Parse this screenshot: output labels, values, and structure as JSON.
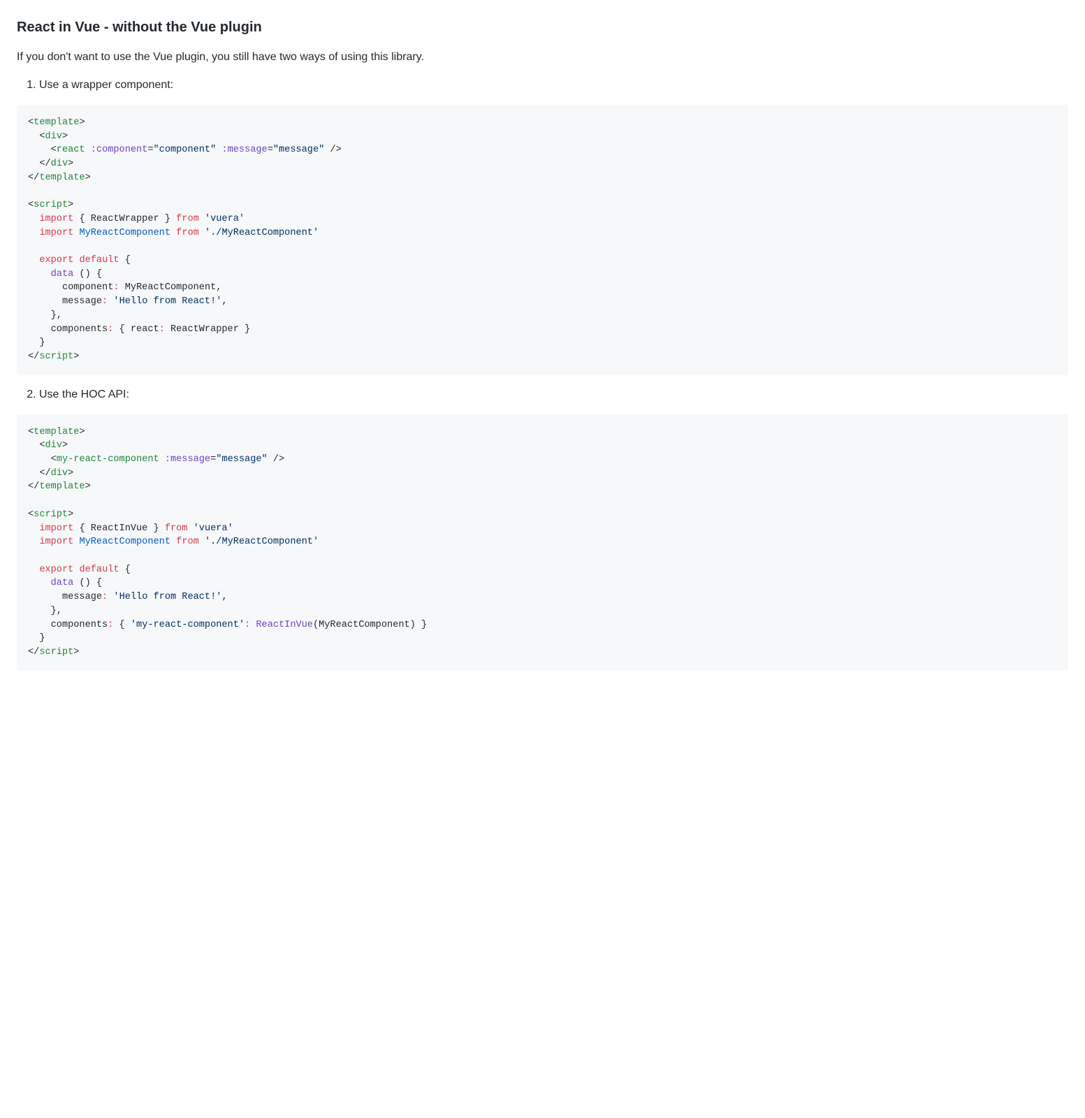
{
  "heading": "React in Vue - without the Vue plugin",
  "intro": "If you don't want to use the Vue plugin, you still have two ways of using this library.",
  "list": {
    "item1": "Use a wrapper component:",
    "item2": "Use the HOC API:"
  },
  "code1": {
    "tokens": [
      {
        "c": "pl-txt",
        "t": "<"
      },
      {
        "c": "pl-tag",
        "t": "template"
      },
      {
        "c": "pl-txt",
        "t": ">\n  <"
      },
      {
        "c": "pl-tag",
        "t": "div"
      },
      {
        "c": "pl-txt",
        "t": ">\n    <"
      },
      {
        "c": "pl-tag",
        "t": "react"
      },
      {
        "c": "pl-txt",
        "t": " "
      },
      {
        "c": "pl-attr",
        "t": ":component"
      },
      {
        "c": "pl-txt",
        "t": "="
      },
      {
        "c": "pl-str",
        "t": "\"component\""
      },
      {
        "c": "pl-txt",
        "t": " "
      },
      {
        "c": "pl-attr",
        "t": ":message"
      },
      {
        "c": "pl-txt",
        "t": "="
      },
      {
        "c": "pl-str",
        "t": "\"message\""
      },
      {
        "c": "pl-txt",
        "t": " />\n  </"
      },
      {
        "c": "pl-tag",
        "t": "div"
      },
      {
        "c": "pl-txt",
        "t": ">\n</"
      },
      {
        "c": "pl-tag",
        "t": "template"
      },
      {
        "c": "pl-txt",
        "t": ">\n\n<"
      },
      {
        "c": "pl-tag",
        "t": "script"
      },
      {
        "c": "pl-txt",
        "t": ">\n  "
      },
      {
        "c": "pl-kw",
        "t": "import"
      },
      {
        "c": "pl-txt",
        "t": " { ReactWrapper } "
      },
      {
        "c": "pl-kw",
        "t": "from"
      },
      {
        "c": "pl-txt",
        "t": " "
      },
      {
        "c": "pl-str",
        "t": "'vuera'"
      },
      {
        "c": "pl-txt",
        "t": "\n  "
      },
      {
        "c": "pl-kw",
        "t": "import"
      },
      {
        "c": "pl-txt",
        "t": " "
      },
      {
        "c": "pl-def",
        "t": "MyReactComponent"
      },
      {
        "c": "pl-txt",
        "t": " "
      },
      {
        "c": "pl-kw",
        "t": "from"
      },
      {
        "c": "pl-txt",
        "t": " "
      },
      {
        "c": "pl-str",
        "t": "'./MyReactComponent'"
      },
      {
        "c": "pl-txt",
        "t": "\n\n  "
      },
      {
        "c": "pl-kw",
        "t": "export"
      },
      {
        "c": "pl-txt",
        "t": " "
      },
      {
        "c": "pl-kw",
        "t": "default"
      },
      {
        "c": "pl-txt",
        "t": " {\n    "
      },
      {
        "c": "pl-fn",
        "t": "data"
      },
      {
        "c": "pl-txt",
        "t": " () {\n      component"
      },
      {
        "c": "pl-kw",
        "t": ":"
      },
      {
        "c": "pl-txt",
        "t": " MyReactComponent,\n      message"
      },
      {
        "c": "pl-kw",
        "t": ":"
      },
      {
        "c": "pl-txt",
        "t": " "
      },
      {
        "c": "pl-str",
        "t": "'Hello from React!'"
      },
      {
        "c": "pl-txt",
        "t": ",\n    },\n    components"
      },
      {
        "c": "pl-kw",
        "t": ":"
      },
      {
        "c": "pl-txt",
        "t": " { react"
      },
      {
        "c": "pl-kw",
        "t": ":"
      },
      {
        "c": "pl-txt",
        "t": " ReactWrapper }\n  }\n</"
      },
      {
        "c": "pl-tag",
        "t": "script"
      },
      {
        "c": "pl-txt",
        "t": ">"
      }
    ]
  },
  "code2": {
    "tokens": [
      {
        "c": "pl-txt",
        "t": "<"
      },
      {
        "c": "pl-tag",
        "t": "template"
      },
      {
        "c": "pl-txt",
        "t": ">\n  <"
      },
      {
        "c": "pl-tag",
        "t": "div"
      },
      {
        "c": "pl-txt",
        "t": ">\n    <"
      },
      {
        "c": "pl-tag",
        "t": "my-react-component"
      },
      {
        "c": "pl-txt",
        "t": " "
      },
      {
        "c": "pl-attr",
        "t": ":message"
      },
      {
        "c": "pl-txt",
        "t": "="
      },
      {
        "c": "pl-str",
        "t": "\"message\""
      },
      {
        "c": "pl-txt",
        "t": " />\n  </"
      },
      {
        "c": "pl-tag",
        "t": "div"
      },
      {
        "c": "pl-txt",
        "t": ">\n</"
      },
      {
        "c": "pl-tag",
        "t": "template"
      },
      {
        "c": "pl-txt",
        "t": ">\n\n<"
      },
      {
        "c": "pl-tag",
        "t": "script"
      },
      {
        "c": "pl-txt",
        "t": ">\n  "
      },
      {
        "c": "pl-kw",
        "t": "import"
      },
      {
        "c": "pl-txt",
        "t": " { ReactInVue } "
      },
      {
        "c": "pl-kw",
        "t": "from"
      },
      {
        "c": "pl-txt",
        "t": " "
      },
      {
        "c": "pl-str",
        "t": "'vuera'"
      },
      {
        "c": "pl-txt",
        "t": "\n  "
      },
      {
        "c": "pl-kw",
        "t": "import"
      },
      {
        "c": "pl-txt",
        "t": " "
      },
      {
        "c": "pl-def",
        "t": "MyReactComponent"
      },
      {
        "c": "pl-txt",
        "t": " "
      },
      {
        "c": "pl-kw",
        "t": "from"
      },
      {
        "c": "pl-txt",
        "t": " "
      },
      {
        "c": "pl-str",
        "t": "'./MyReactComponent'"
      },
      {
        "c": "pl-txt",
        "t": "\n\n  "
      },
      {
        "c": "pl-kw",
        "t": "export"
      },
      {
        "c": "pl-txt",
        "t": " "
      },
      {
        "c": "pl-kw",
        "t": "default"
      },
      {
        "c": "pl-txt",
        "t": " {\n    "
      },
      {
        "c": "pl-fn",
        "t": "data"
      },
      {
        "c": "pl-txt",
        "t": " () {\n      message"
      },
      {
        "c": "pl-kw",
        "t": ":"
      },
      {
        "c": "pl-txt",
        "t": " "
      },
      {
        "c": "pl-str",
        "t": "'Hello from React!'"
      },
      {
        "c": "pl-txt",
        "t": ",\n    },\n    components"
      },
      {
        "c": "pl-kw",
        "t": ":"
      },
      {
        "c": "pl-txt",
        "t": " { "
      },
      {
        "c": "pl-str",
        "t": "'my-react-component'"
      },
      {
        "c": "pl-kw",
        "t": ":"
      },
      {
        "c": "pl-txt",
        "t": " "
      },
      {
        "c": "pl-fn",
        "t": "ReactInVue"
      },
      {
        "c": "pl-txt",
        "t": "(MyReactComponent) }\n  }\n</"
      },
      {
        "c": "pl-tag",
        "t": "script"
      },
      {
        "c": "pl-txt",
        "t": ">"
      }
    ]
  }
}
